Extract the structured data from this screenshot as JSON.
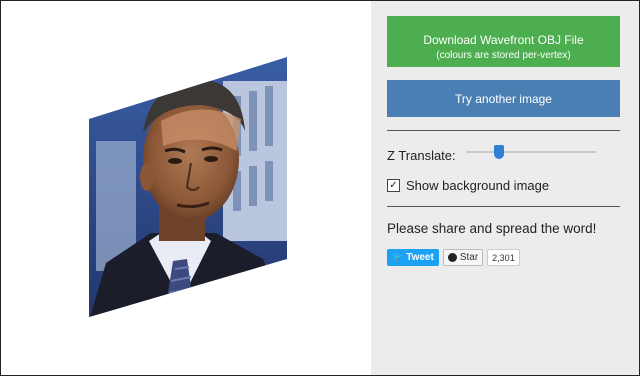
{
  "actions": {
    "download_label": "Download Wavefront OBJ File",
    "download_sub": "(colours are stored per-vertex)",
    "try_label": "Try another image"
  },
  "controls": {
    "z_translate_label": "Z Translate:",
    "z_translate_value": 0.25,
    "show_bg_label": "Show background image",
    "show_bg_checked": true
  },
  "share": {
    "text": "Please share and spread the word!",
    "tweet_label": "Tweet",
    "star_label": "Star",
    "star_count": "2,301"
  },
  "colors": {
    "download": "#4cae4f",
    "try": "#4a7fb3",
    "panel": "#ececec",
    "tweet": "#1da1f2"
  }
}
